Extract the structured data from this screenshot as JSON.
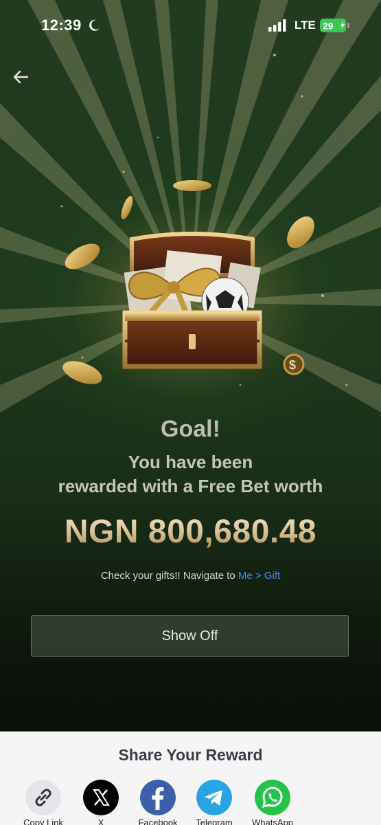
{
  "status_bar": {
    "time": "12:39",
    "network": "LTE",
    "battery": "29"
  },
  "reward": {
    "headline": "Goal!",
    "message_line1": "You have been",
    "message_line2": "rewarded with a Free Bet worth",
    "amount": "NGN 800,680.48",
    "hint_prefix": "Check your gifts!! Navigate to ",
    "hint_link": "Me > Gift",
    "show_off_label": "Show Off"
  },
  "share": {
    "title": "Share Your Reward",
    "options": [
      {
        "label": "Copy Link",
        "icon": "link-icon",
        "color": "#e4e4ea"
      },
      {
        "label": "X",
        "icon": "x-logo-icon",
        "color": "#000000"
      },
      {
        "label": "Facebook",
        "icon": "facebook-icon",
        "color": "#3b5fa8"
      },
      {
        "label": "Telegram",
        "icon": "telegram-icon",
        "color": "#2aa3e3"
      },
      {
        "label": "WhatsApp",
        "icon": "whatsapp-icon",
        "color": "#25c24a"
      }
    ]
  },
  "colors": {
    "accent_link": "#3d8ef0",
    "gold": "#d4be8f"
  }
}
